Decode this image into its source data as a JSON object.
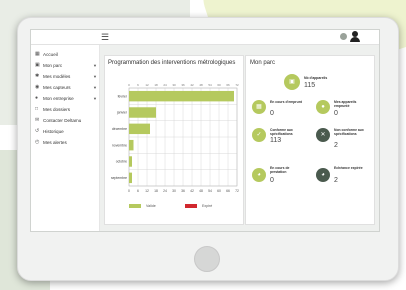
{
  "header": {
    "menu_icon": "hamburger-icon",
    "settings_icon": "settings-icon",
    "user_icon": "user-icon"
  },
  "sidebar": {
    "items": [
      {
        "label": "Accueil",
        "icon": "grid-icon",
        "has_caret": false
      },
      {
        "label": "Mon parc",
        "icon": "truck-icon",
        "has_caret": true
      },
      {
        "label": "Mes modèles",
        "icon": "gear-icon",
        "has_caret": true
      },
      {
        "label": "Mes capteurs",
        "icon": "sensor-icon",
        "has_caret": true
      },
      {
        "label": "Mon entreprise",
        "icon": "globe-icon",
        "has_caret": true
      },
      {
        "label": "Mes dossiers",
        "icon": "folder-icon",
        "has_caret": false
      },
      {
        "label": "Contacter Deltamu",
        "icon": "mail-icon",
        "has_caret": false
      },
      {
        "label": "Historique",
        "icon": "history-icon",
        "has_caret": false
      },
      {
        "label": "Mes alertes",
        "icon": "alert-icon",
        "has_caret": false
      }
    ]
  },
  "chart_panel": {
    "title": "Programmation des interventions métrologiques",
    "legend": [
      {
        "label": "Valide",
        "color": "#b5c95e"
      },
      {
        "label": "Expiré",
        "color": "#d1282e"
      }
    ]
  },
  "chart_data": {
    "type": "bar",
    "orientation": "horizontal",
    "categories": [
      "février",
      "janvier",
      "décembre",
      "novembre",
      "octobre",
      "septembre"
    ],
    "series": [
      {
        "name": "Valide",
        "values": [
          70,
          18,
          14,
          3,
          2,
          2
        ],
        "color": "#b5c95e"
      },
      {
        "name": "Expiré",
        "values": [
          0,
          0,
          0,
          0,
          0,
          0
        ],
        "color": "#d1282e"
      }
    ],
    "x_ticks": [
      "0",
      "6",
      "12",
      "18",
      "24",
      "30",
      "36",
      "42",
      "48",
      "54",
      "60",
      "66",
      "72"
    ],
    "top_ticks": [
      "0",
      "6",
      "12",
      "18",
      "24",
      "30",
      "36",
      "42",
      "48",
      "54",
      "60",
      "66",
      "72"
    ],
    "xlim": [
      0,
      72
    ],
    "grid": true
  },
  "parc_panel": {
    "title": "Mon parc",
    "cards": [
      {
        "label": "Nb d'appareils",
        "value": "115",
        "icon": "truck-icon",
        "color": "#b5c95e"
      },
      {
        "label": "En cours d'emprunt",
        "value": "0",
        "icon": "calendar-icon",
        "color": "#b5c95e"
      },
      {
        "label": "Mes appareils emprunté",
        "value": "0",
        "icon": "users-icon",
        "color": "#b5c95e"
      },
      {
        "label": "Conforme aux spécifications",
        "value": "113",
        "icon": "check-icon",
        "color": "#b5c95e"
      },
      {
        "label": "Non conforme aux spécifications",
        "value": "2",
        "icon": "cross-icon",
        "color": "#4a5a4e"
      },
      {
        "label": "En cours de prestation",
        "value": "0",
        "icon": "gauge-icon",
        "color": "#b5c95e"
      },
      {
        "label": "Echéance expirée",
        "value": "2",
        "icon": "gauge-icon",
        "color": "#4a5a4e"
      }
    ]
  }
}
